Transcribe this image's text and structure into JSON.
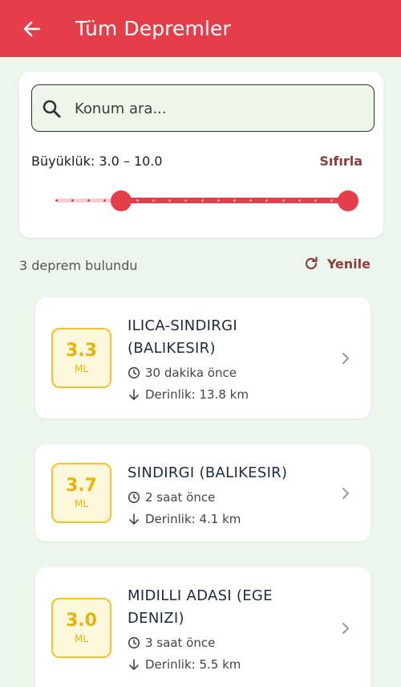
{
  "appbar": {
    "title": "Tüm Depremler",
    "color": "#e53e4a"
  },
  "filter": {
    "search_placeholder": "Konum ara...",
    "range_label": "Büyüklük: 3.0 – 10.0",
    "reset_label": "Sıfırla",
    "slider": {
      "min": 1.0,
      "max": 10.0,
      "low": 3.0,
      "high": 10.0,
      "step": 0.5
    }
  },
  "results": {
    "count_text": "3 deprem bulundu",
    "refresh_label": "Yenile"
  },
  "earthquakes": [
    {
      "magnitude": "3.3",
      "type": "ML",
      "location": "ILICA-SINDIRGI (BALIKESIR)",
      "time_ago": "30 dakika önce",
      "depth": "Derinlik: 13.8 km"
    },
    {
      "magnitude": "3.7",
      "type": "ML",
      "location": "SINDIRGI (BALIKESIR)",
      "time_ago": "2 saat önce",
      "depth": "Derinlik: 4.1 km"
    },
    {
      "magnitude": "3.0",
      "type": "ML",
      "location": "MIDILLI ADASI (EGE DENIZI)",
      "time_ago": "3 saat önce",
      "depth": "Derinlik: 5.5 km"
    }
  ],
  "icons": {
    "back": "arrow-back-icon",
    "search": "search-icon",
    "refresh": "refresh-icon",
    "clock": "clock-icon",
    "depth": "arrow-down-icon",
    "chevron": "chevron-right-icon"
  }
}
